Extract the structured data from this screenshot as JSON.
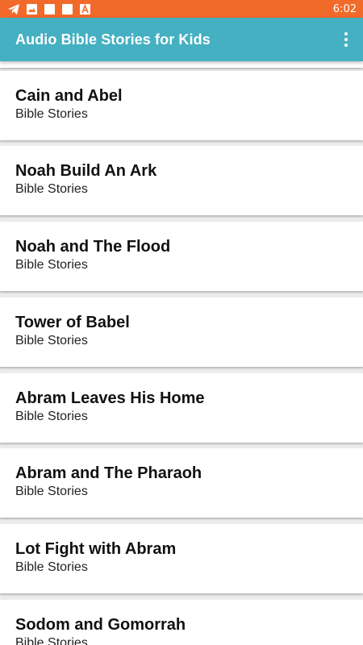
{
  "status_bar": {
    "time": "6:02",
    "icons": [
      "telegram-icon",
      "image-icon",
      "notification-square-icon",
      "notification-square-icon",
      "app-notification-icon"
    ]
  },
  "app_bar": {
    "title": "Audio Bible Stories for Kids",
    "menu_icon": "more-vert-icon"
  },
  "stories": [
    {
      "title": "Cain and Abel",
      "subtitle": "Bible Stories"
    },
    {
      "title": "Noah Build An Ark",
      "subtitle": "Bible Stories"
    },
    {
      "title": "Noah and The Flood",
      "subtitle": "Bible Stories"
    },
    {
      "title": "Tower of Babel",
      "subtitle": "Bible Stories"
    },
    {
      "title": "Abram Leaves His Home",
      "subtitle": "Bible Stories"
    },
    {
      "title": "Abram and The Pharaoh",
      "subtitle": "Bible Stories"
    },
    {
      "title": "Lot Fight with Abram",
      "subtitle": "Bible Stories"
    },
    {
      "title": "Sodom and Gomorrah",
      "subtitle": "Bible Stories"
    }
  ],
  "colors": {
    "status_bar": "#f26a2a",
    "app_bar": "#45b0c2",
    "card": "#ffffff",
    "background": "#ececec"
  }
}
